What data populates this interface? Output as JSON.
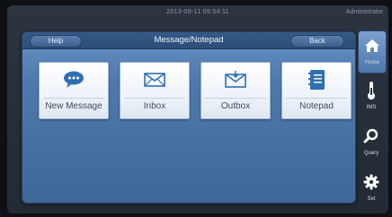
{
  "status_bar": {
    "datetime": "2013-09-11  09:54:11",
    "user": "Administrator"
  },
  "panel": {
    "title": "Message/Notepad",
    "help_label": "Help",
    "back_label": "Back"
  },
  "tiles": [
    {
      "label": "New Message",
      "icon": "speech-bubble-icon"
    },
    {
      "label": "Inbox",
      "icon": "envelope-icon"
    },
    {
      "label": "Outbox",
      "icon": "envelope-out-icon"
    },
    {
      "label": "Notepad",
      "icon": "notepad-icon"
    }
  ],
  "sidebar": [
    {
      "label": "Home",
      "icon": "home-icon",
      "active": true
    },
    {
      "label": "IMS",
      "icon": "thermometer-icon",
      "active": false
    },
    {
      "label": "Query",
      "icon": "search-icon",
      "active": false
    },
    {
      "label": "Set",
      "icon": "gear-icon",
      "active": false
    }
  ],
  "colors": {
    "panel_blue": "#4f79ad",
    "tile_label": "#3e4e62",
    "icon_blue": "#2f6fb4"
  }
}
